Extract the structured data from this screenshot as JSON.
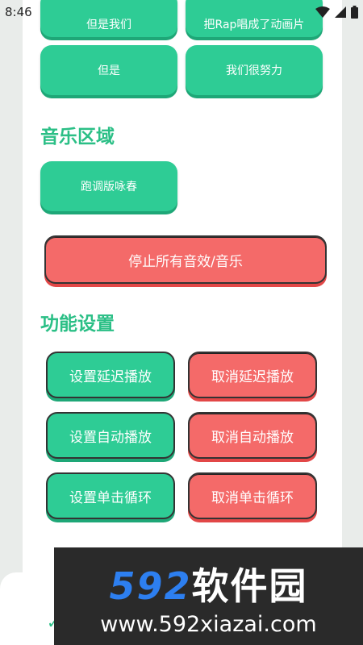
{
  "status": {
    "time": "8:46",
    "icons": [
      "wifi-icon",
      "signal-icon",
      "battery-icon"
    ]
  },
  "top_buttons": [
    "但是我们",
    "把Rap唱成了动画片",
    "但是",
    "我们很努力"
  ],
  "music_section": {
    "title": "音乐区域",
    "buttons": [
      "跑调版咏春"
    ],
    "stop_button": "停止所有音效/音乐"
  },
  "settings_section": {
    "title": "功能设置",
    "rows": [
      {
        "set": "设置延迟播放",
        "cancel": "取消延迟播放"
      },
      {
        "set": "设置自动播放",
        "cancel": "取消自动播放"
      },
      {
        "set": "设置单击循环",
        "cancel": "取消单击循环"
      }
    ]
  },
  "watermark": {
    "number": "592",
    "brand": "软件园",
    "url": "www.592xiazai.com"
  },
  "colors": {
    "green": "#2ecc95",
    "red": "#f46a69",
    "title_green": "#2bbf86"
  }
}
